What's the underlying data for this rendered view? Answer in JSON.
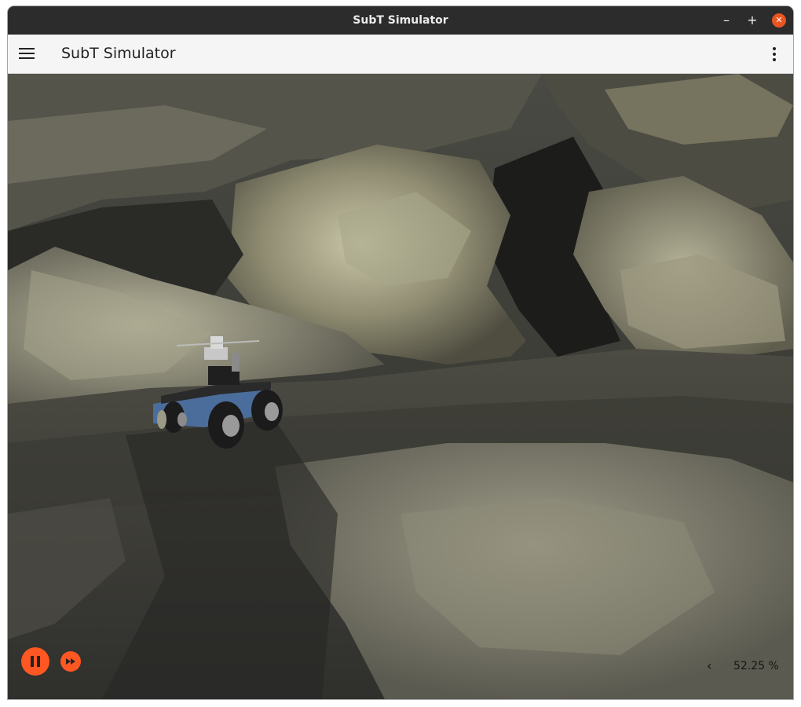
{
  "window": {
    "title": "SubT Simulator",
    "controls": {
      "minimize": "–",
      "maximize": "+",
      "close": "✕"
    },
    "accent_color": "#e95420"
  },
  "appbar": {
    "title": "SubT Simulator",
    "menu_icon": "hamburger-menu-icon",
    "more_icon": "more-vert-icon"
  },
  "scene": {
    "description_icon": "3d-scene",
    "robot_color": "#4b6d9b"
  },
  "playback": {
    "pause_icon": "pause-icon",
    "step_icon": "fast-forward-icon",
    "button_color": "#ff5722"
  },
  "status": {
    "rtf_toggle": "‹",
    "real_time_factor": "52.25 %"
  }
}
